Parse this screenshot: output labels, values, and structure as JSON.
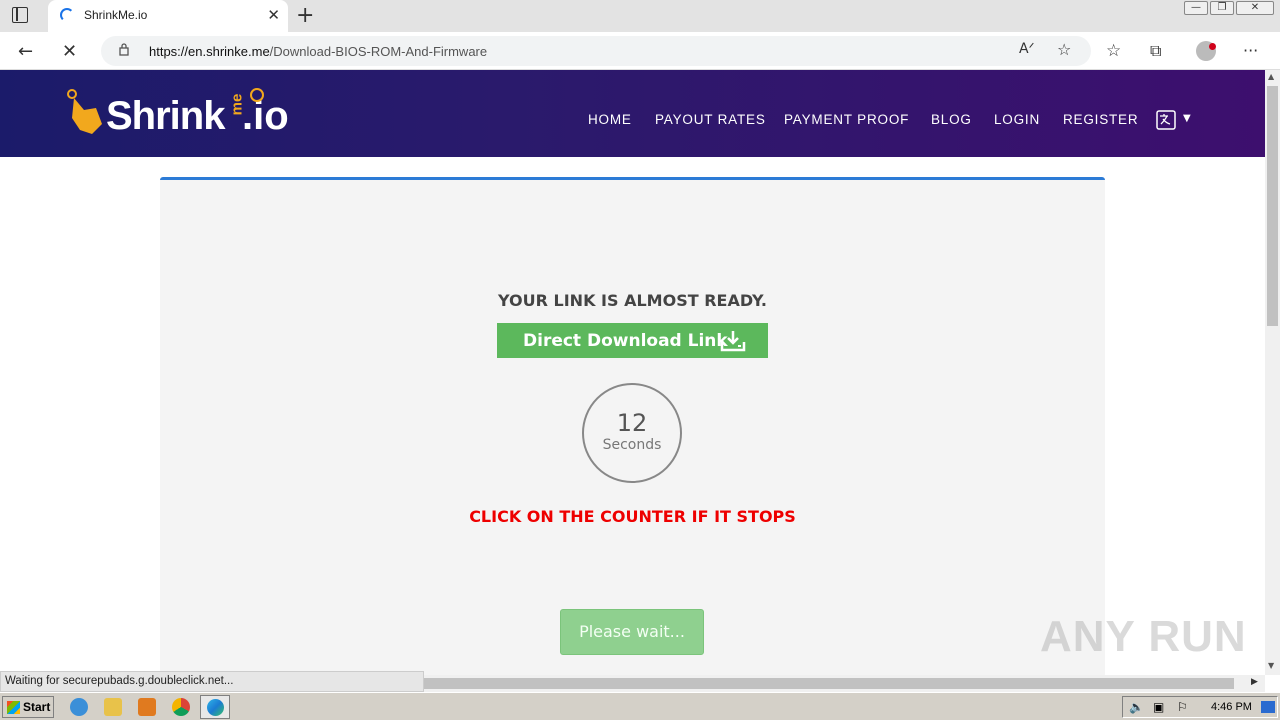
{
  "browser": {
    "tab_title": "ShrinkMe.io",
    "url_host": "https://en.shrinke.me",
    "url_path": "/Download-BIOS-ROM-And-Firmware",
    "status_text": "Waiting for securepubads.g.doubleclick.net..."
  },
  "site": {
    "logo_text": "Shrink",
    "logo_me": "me",
    "logo_io": ".io",
    "nav": [
      "HOME",
      "PAYOUT RATES",
      "PAYMENT PROOF",
      "BLOG",
      "LOGIN",
      "REGISTER"
    ]
  },
  "main": {
    "heading": "YOUR LINK IS ALMOST READY.",
    "download_label": "Direct Download Link",
    "counter_value": "12",
    "counter_unit": "Seconds",
    "click_notice": "CLICK ON THE COUNTER IF IT STOPS",
    "wait_label": "Please wait..."
  },
  "watermark": "ANY RUN",
  "taskbar": {
    "start_label": "Start",
    "clock": "4:46 PM"
  },
  "colors": {
    "header_gradient_start": "#1b1b6a",
    "header_gradient_end": "#3d0f6e",
    "download_button": "#5cb85c",
    "notice_red": "#ee0000",
    "card_border": "#2c7bd6",
    "logo_accent": "#f2a81d"
  },
  "icons": [
    "tab-actions-icon",
    "loading-spinner-icon",
    "close-icon",
    "plus-icon",
    "back-arrow-icon",
    "stop-icon",
    "lock-icon",
    "read-aloud-icon",
    "add-favorite-icon",
    "favorites-icon",
    "collections-icon",
    "profile-icon",
    "more-icon",
    "language-icon",
    "download-icon"
  ]
}
